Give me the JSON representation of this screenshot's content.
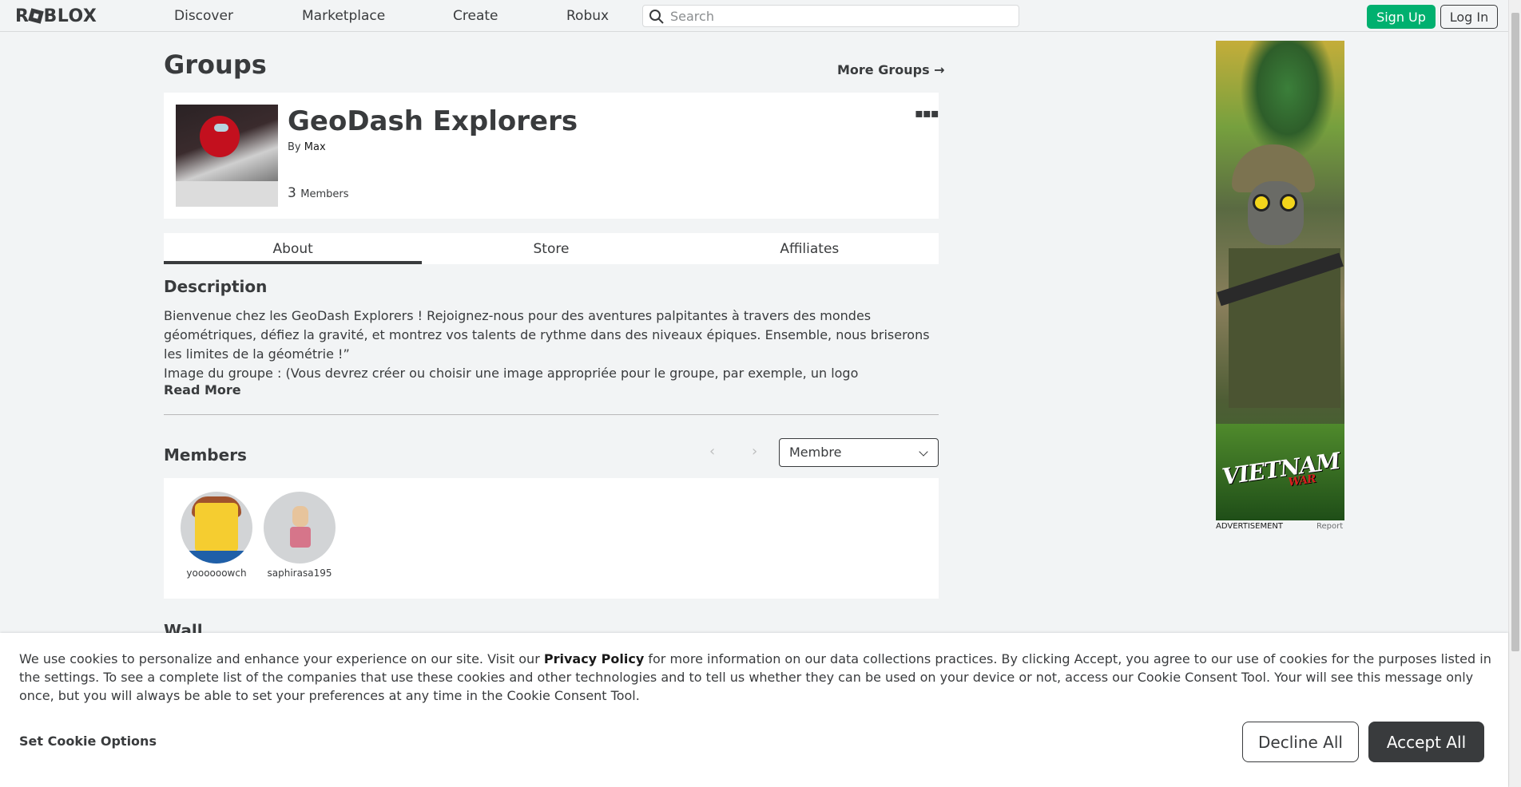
{
  "header": {
    "logo_text": "ROBLOX",
    "nav": [
      {
        "label": "Discover"
      },
      {
        "label": "Marketplace"
      },
      {
        "label": "Create"
      },
      {
        "label": "Robux"
      }
    ],
    "search_placeholder": "Search",
    "signup_label": "Sign Up",
    "login_label": "Log In",
    "signup_color": "#00b06f"
  },
  "page": {
    "title": "Groups",
    "more_groups_label": "More Groups →"
  },
  "group": {
    "name": "GeoDash Explorers",
    "by_prefix": "By",
    "owner": "Max",
    "member_count": "3",
    "member_label": "Members",
    "menu_icon": "ellipsis-icon"
  },
  "tabs": [
    {
      "label": "About",
      "active": true
    },
    {
      "label": "Store",
      "active": false
    },
    {
      "label": "Affiliates",
      "active": false
    }
  ],
  "description": {
    "title": "Description",
    "lines": [
      "Bienvenue chez les GeoDash Explorers ! Rejoignez-nous pour des aventures palpitantes à travers des mondes géométriques, défiez la gravité, et montrez vos talents de rythme dans des niveaux épiques. Ensemble, nous briserons les limites de la géométrie !”",
      "Image du groupe : (Vous devrez créer ou choisir une image appropriée pour le groupe, par exemple, un logo"
    ],
    "read_more": "Read More"
  },
  "members": {
    "title": "Members",
    "role_selected": "Membre",
    "list": [
      {
        "name": "yoooooowch"
      },
      {
        "name": "saphirasa195"
      }
    ]
  },
  "wall": {
    "title": "Wall"
  },
  "ad": {
    "logo": "VIETNAM",
    "logo_sub": "WAR",
    "label": "ADVERTISEMENT",
    "report": "Report"
  },
  "cookie": {
    "text_before": "We use cookies to personalize and enhance your experience on our site. Visit our",
    "link": "Privacy Policy",
    "text_after": "for more information on our data collections practices. By clicking Accept, you agree to our use of cookies for the purposes listed in the settings. To see a complete list of the companies that use these cookies and other technologies and to tell us whether they can be used on your device or not, access our Cookie Consent Tool. Your will see this message only once, but you will always be able to set your preferences at any time in the Cookie Consent Tool.",
    "options_label": "Set Cookie Options",
    "decline_label": "Decline All",
    "accept_label": "Accept All"
  }
}
